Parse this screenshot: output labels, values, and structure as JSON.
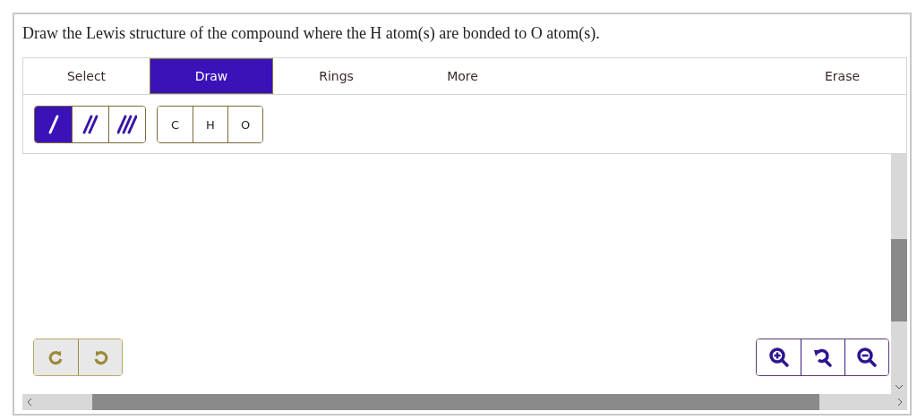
{
  "question": "Draw the Lewis structure of the compound where the H atom(s) are bonded to O atom(s).",
  "tabs": [
    {
      "label": "Select",
      "selected": false
    },
    {
      "label": "Draw",
      "selected": true
    },
    {
      "label": "Rings",
      "selected": false
    },
    {
      "label": "More",
      "selected": false
    },
    {
      "label": "Erase",
      "selected": false
    }
  ],
  "bond_tools": [
    {
      "kind": "single",
      "selected": true
    },
    {
      "kind": "double",
      "selected": false
    },
    {
      "kind": "triple",
      "selected": false
    }
  ],
  "atoms": [
    {
      "label": "C",
      "selected": false
    },
    {
      "label": "H",
      "selected": false
    },
    {
      "label": "O",
      "selected": false
    }
  ],
  "history_buttons": [
    {
      "kind": "redo"
    },
    {
      "kind": "undo"
    }
  ],
  "zoom_buttons": [
    {
      "kind": "zoom-in"
    },
    {
      "kind": "reset"
    },
    {
      "kind": "zoom-out"
    }
  ]
}
